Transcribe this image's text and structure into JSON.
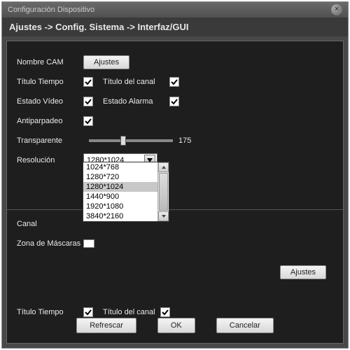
{
  "window": {
    "title": "Configuración Dispositivo"
  },
  "breadcrumb": "Ajustes -> Config. Sistema -> Interfaz/GUI",
  "labels": {
    "nombreCam": "Nombre CAM",
    "ajustes": "Ajustes",
    "tituloTiempo": "Título Tiempo",
    "tituloCanal": "Título del canal",
    "estadoVideo": "Estado Vídeo",
    "estadoAlarma": "Estado Alarma",
    "antiparpadeo": "Antiparpadeo",
    "transparente": "Transparente",
    "resolucion": "Resolución",
    "canal": "Canal",
    "zonaMascaras": "Zona de Máscaras"
  },
  "values": {
    "transparente": "175",
    "resolucion_selected": "1280*1024"
  },
  "checkboxes": {
    "tituloTiempo1": true,
    "tituloCanal1": true,
    "estadoVideo": true,
    "estadoAlarma": true,
    "antiparpadeo": true,
    "tituloTiempo2": true,
    "tituloCanal2": true
  },
  "resolutions": [
    "1024*768",
    "1280*720",
    "1280*1024",
    "1440*900",
    "1920*1080",
    "3840*2160"
  ],
  "buttons": {
    "refrescar": "Refrescar",
    "ok": "OK",
    "cancelar": "Cancelar"
  }
}
